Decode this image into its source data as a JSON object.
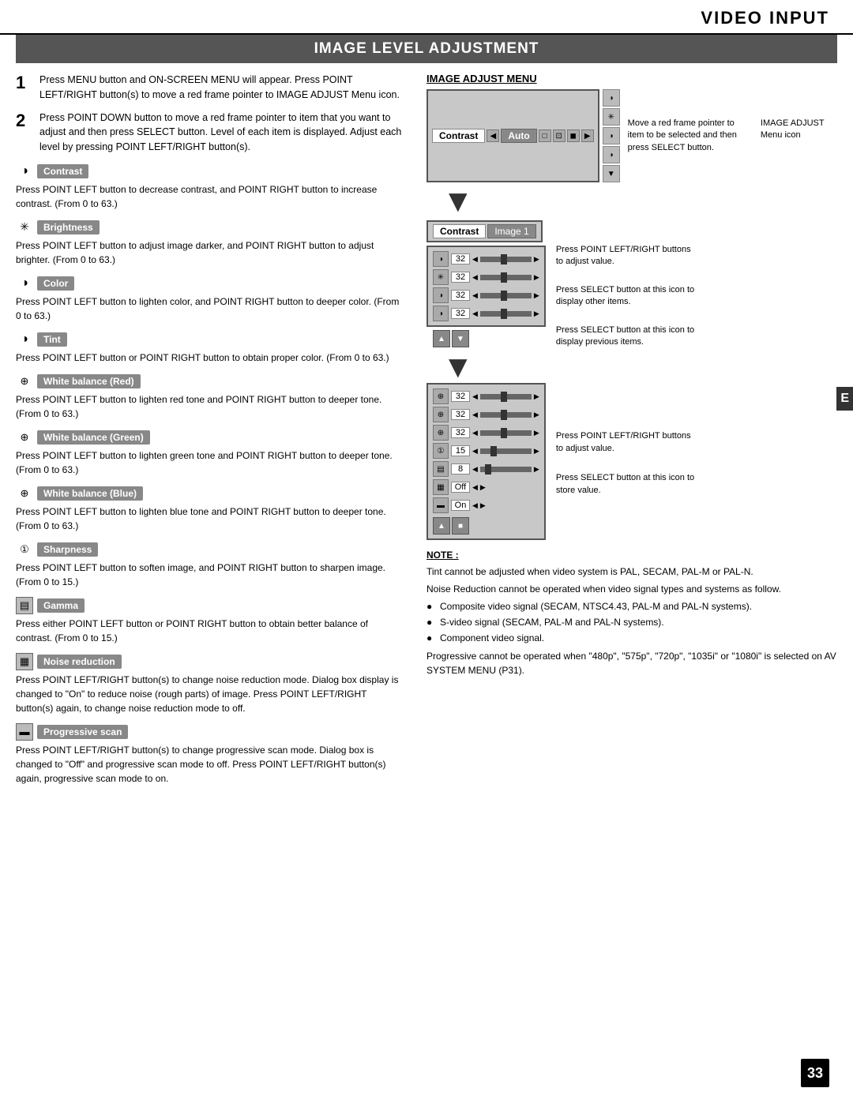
{
  "header": {
    "title": "VIDEO INPUT"
  },
  "section": {
    "title": "IMAGE LEVEL ADJUSTMENT"
  },
  "steps": [
    {
      "num": "1",
      "text": "Press MENU button and ON-SCREEN MENU will appear.  Press POINT LEFT/RIGHT button(s) to move a red frame pointer to IMAGE ADJUST Menu icon."
    },
    {
      "num": "2",
      "text": "Press POINT DOWN button to move a red frame pointer to item that you want to adjust and then press SELECT button.  Level of each item is displayed.  Adjust each level by pressing POINT LEFT/RIGHT button(s)."
    }
  ],
  "features": [
    {
      "id": "contrast",
      "label": "Contrast",
      "icon": "◑",
      "desc": "Press POINT LEFT button to decrease contrast, and POINT RIGHT button to increase contrast.  (From 0 to 63.)"
    },
    {
      "id": "brightness",
      "label": "Brightness",
      "icon": "✶",
      "desc": "Press POINT LEFT button to adjust image darker, and POINT RIGHT button to adjust brighter.  (From 0 to 63.)"
    },
    {
      "id": "color",
      "label": "Color",
      "icon": "◑",
      "desc": "Press POINT LEFT button to lighten color, and POINT RIGHT button to deeper color.  (From 0 to 63.)"
    },
    {
      "id": "tint",
      "label": "Tint",
      "icon": "◑",
      "desc": "Press POINT LEFT button or POINT RIGHT button to obtain proper color.  (From 0 to 63.)"
    },
    {
      "id": "white-balance-red",
      "label": "White balance (Red)",
      "icon": "⊛",
      "desc": "Press POINT LEFT button to lighten red tone and POINT RIGHT button to deeper tone.  (From 0 to 63.)"
    },
    {
      "id": "white-balance-green",
      "label": "White balance (Green)",
      "icon": "⊛",
      "desc": "Press POINT LEFT button to lighten green tone and POINT RIGHT button to deeper tone.  (From 0 to 63.)"
    },
    {
      "id": "white-balance-blue",
      "label": "White balance (Blue)",
      "icon": "⊛",
      "desc": "Press POINT LEFT button to lighten blue tone and POINT RIGHT button to deeper tone.  (From 0 to 63.)"
    },
    {
      "id": "sharpness",
      "label": "Sharpness",
      "icon": "①",
      "desc": "Press POINT LEFT button to soften image, and POINT RIGHT button to sharpen image.  (From 0 to 15.)"
    },
    {
      "id": "gamma",
      "label": "Gamma",
      "icon": "▤",
      "desc": "Press either POINT LEFT button or POINT RIGHT button to obtain better balance of contrast.  (From 0 to 15.)"
    },
    {
      "id": "noise-reduction",
      "label": "Noise reduction",
      "icon": "▦",
      "desc": "Press POINT LEFT/RIGHT button(s) to change noise reduction mode. Dialog box display is changed to \"On\" to reduce noise (rough parts) of image. Press POINT LEFT/RIGHT button(s) again, to change noise reduction mode to off."
    },
    {
      "id": "progressive-scan",
      "label": "Progressive scan",
      "icon": "▬",
      "desc": "Press POINT LEFT/RIGHT button(s) to change progressive scan mode.  Dialog box is changed to \"Off\" and progressive scan mode to off.  Press POINT LEFT/RIGHT button(s) again, progressive scan mode to on."
    }
  ],
  "right_panel": {
    "menu_title": "IMAGE ADJUST MENU",
    "menu_label_top": "Contrast",
    "menu_label_auto": "Auto",
    "callout1": {
      "line1": "Move a red frame pointer to",
      "line2": "item to be selected and then",
      "line3": "press SELECT button."
    },
    "callout_image_adjust": {
      "line1": "IMAGE ADJUST",
      "line2": "Menu icon"
    },
    "adj_label_contrast": "Contrast",
    "adj_label_image1": "Image 1",
    "adj_values": [
      "32",
      "32",
      "32",
      "32"
    ],
    "callout2": {
      "line1": "Press POINT LEFT/RIGHT buttons",
      "line2": "to adjust value."
    },
    "callout3": {
      "line1": "Press SELECT button at this icon to",
      "line2": "display other items."
    },
    "callout4": {
      "line1": "Press SELECT button at this icon to",
      "line2": "display previous items."
    },
    "adj_values2": [
      "32",
      "32",
      "32",
      "15",
      "8",
      "Off",
      "On"
    ],
    "callout5": {
      "line1": "Press POINT LEFT/RIGHT buttons",
      "line2": "to adjust value."
    },
    "callout6": {
      "line1": "Press SELECT button at this icon to",
      "line2": "store value."
    }
  },
  "note": {
    "title": "NOTE :",
    "lines": [
      "Tint cannot be adjusted when video system is PAL, SECAM, PAL-M or PAL-N.",
      "Noise Reduction cannot be operated when video signal types and systems as follow."
    ],
    "bullets": [
      "Composite video signal (SECAM, NTSC4.43, PAL-M and PAL-N systems).",
      "S-video signal (SECAM, PAL-M and PAL-N systems).",
      "Component video signal."
    ],
    "progressive_note": "Progressive cannot be operated when \"480p\", \"575p\", \"720p\", \"1035i\" or \"1080i\" is selected on AV SYSTEM MENU (P31)."
  },
  "page_number": "33",
  "e_tab": "E"
}
